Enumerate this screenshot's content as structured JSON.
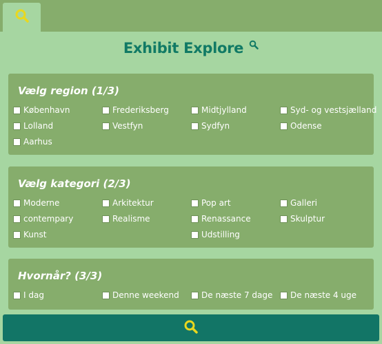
{
  "header": {
    "tab_icon": "search-icon"
  },
  "title": {
    "text": "Exhibit Explore",
    "icon": "search-icon"
  },
  "region": {
    "heading": "Vælg region (1/3)",
    "options": [
      "København",
      "Frederiksberg",
      "Midtjylland",
      "Syd- og vestsjælland",
      "Lolland",
      "Vestfyn",
      "Sydfyn",
      "Odense",
      "Aarhus"
    ]
  },
  "kategori": {
    "heading": "Vælg kategori (2/3)",
    "options": [
      "Moderne",
      "Arkitektur",
      "Pop art",
      "Galleri",
      "contempary",
      "Realisme",
      "Renassance",
      "Skulptur",
      "Kunst",
      "Udstilling"
    ]
  },
  "hvornaar": {
    "heading": "Hvornår? (3/3)",
    "options": [
      "I dag",
      "Denne weekend",
      "De næste 7 dage",
      "De næste 4 uge"
    ]
  },
  "search_button": {
    "icon": "search-icon"
  },
  "colors": {
    "accent": "#117a65",
    "icon_yellow": "#e9d81e",
    "panel": "#86ad6c",
    "background": "#a6d6a1"
  }
}
